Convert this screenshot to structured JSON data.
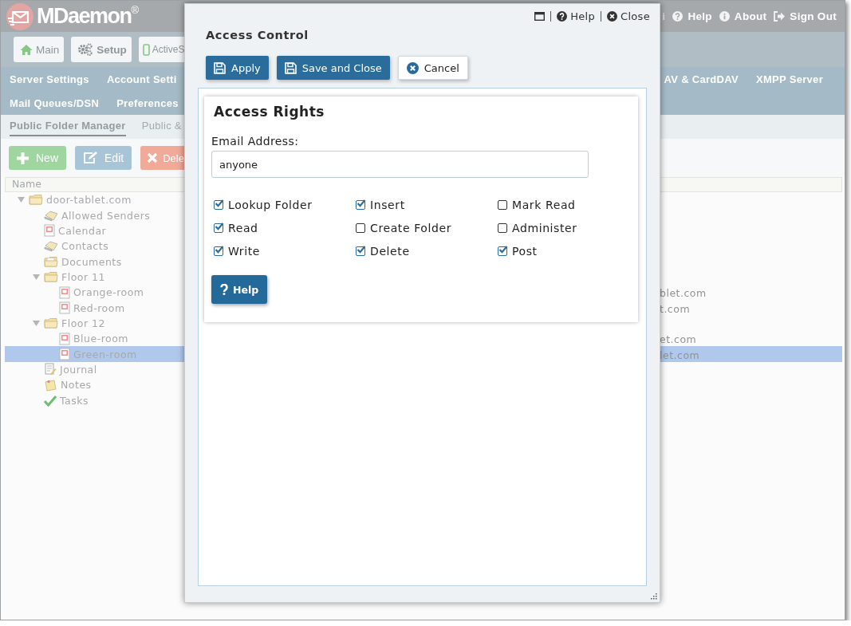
{
  "header": {
    "logo": "MDaemon$^{®}$",
    "links": [
      {
        "kind": "partial",
        "label": "i"
      },
      {
        "kind": "help",
        "label": "Help"
      },
      {
        "kind": "about",
        "label": "About"
      },
      {
        "kind": "signout",
        "label": "Sign Out"
      }
    ]
  },
  "toolbar": [
    {
      "kind": "home",
      "label": "Main"
    },
    {
      "kind": "setup",
      "label": "Setup"
    },
    {
      "kind": "mobile",
      "label": "ActiveS"
    }
  ],
  "nav_menu": {
    "left_rows": [
      [
        "Server Settings",
        "Account Setti"
      ],
      [
        "Mail Queues/DSN",
        "Preferences"
      ]
    ],
    "right_rows": [
      [
        "AV & CardDAV",
        "XMPP Server"
      ]
    ]
  },
  "sub_tabs": [
    {
      "label": "Public Folder Manager",
      "selected": true
    },
    {
      "label": "Public &",
      "selected": false
    }
  ],
  "actions": [
    {
      "kind": "new",
      "label": "New"
    },
    {
      "kind": "edit",
      "label": "Edit"
    },
    {
      "kind": "delete",
      "label": "Dele"
    }
  ],
  "tree": {
    "column_1": "Name",
    "items": [
      {
        "label": "door-tablet.com",
        "kind": "folder",
        "expanded": true,
        "selected": false,
        "children": [
          {
            "label": "Allowed Senders",
            "kind": "contacts",
            "selected": false
          },
          {
            "label": "Calendar",
            "kind": "calendar",
            "selected": false
          },
          {
            "label": "Contacts",
            "kind": "contacts",
            "selected": false
          },
          {
            "label": "Documents",
            "kind": "documents",
            "selected": false
          },
          {
            "label": "Floor 11",
            "kind": "folder",
            "expanded": true,
            "selected": false,
            "children": [
              {
                "label": "Orange-room",
                "kind": "calendar",
                "selected": false,
                "column_2": "blet.com"
              },
              {
                "label": "Red-room",
                "kind": "calendar",
                "selected": false,
                "column_2": "t.com"
              }
            ]
          },
          {
            "label": "Floor 12",
            "kind": "folder",
            "expanded": true,
            "selected": false,
            "children": [
              {
                "label": "Blue-room",
                "kind": "calendar",
                "selected": false,
                "column_2": "et.com"
              },
              {
                "label": "Green-room",
                "kind": "calendar",
                "selected": true,
                "column_2": "let.com"
              }
            ]
          },
          {
            "label": "Journal",
            "kind": "journal",
            "selected": false
          },
          {
            "label": "Notes",
            "kind": "notes",
            "selected": false
          },
          {
            "label": "Tasks",
            "kind": "tasks",
            "selected": false
          }
        ]
      }
    ]
  },
  "dialog": {
    "title": "Access Control",
    "links": [
      {
        "kind": "window"
      },
      {
        "kind": "help",
        "label": "Help"
      },
      {
        "kind": "close",
        "label": "Close"
      }
    ],
    "buttons": [
      {
        "kind": "apply",
        "label": "Apply"
      },
      {
        "kind": "save",
        "label": "Save and Close"
      },
      {
        "kind": "cancel",
        "label": "Cancel"
      }
    ],
    "panel": {
      "title": "Access Rights",
      "email_label": "Email Address:",
      "email_value": "anyone",
      "rights": [
        {
          "label": "Lookup Folder",
          "checked": true
        },
        {
          "label": "Insert",
          "checked": true
        },
        {
          "label": "Mark Read",
          "checked": false
        },
        {
          "label": "Read",
          "checked": true
        },
        {
          "label": "Create Folder",
          "checked": false
        },
        {
          "label": "Administer",
          "checked": false
        },
        {
          "label": "Write",
          "checked": true
        },
        {
          "label": "Delete",
          "checked": true
        },
        {
          "label": "Post",
          "checked": true
        }
      ],
      "help_button": "Help"
    }
  }
}
